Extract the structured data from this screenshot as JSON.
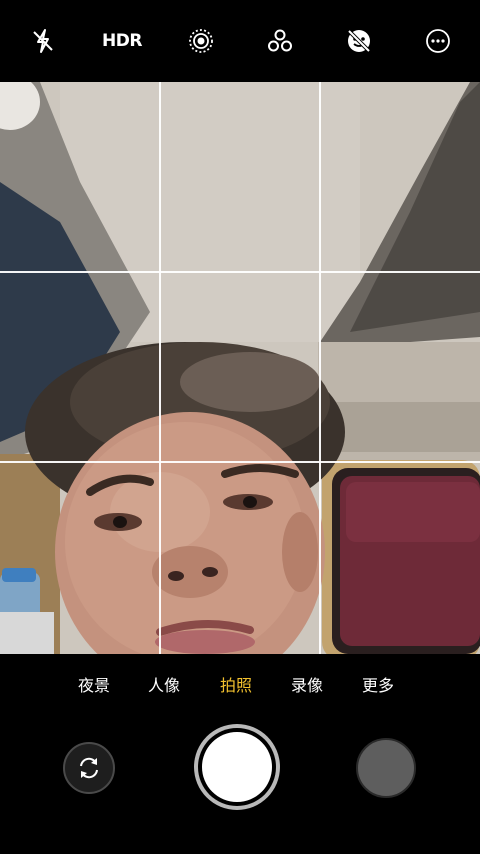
{
  "top_toolbar": {
    "icons": [
      "flash-off-icon",
      "hdr-off-icon",
      "live-photo-icon",
      "filters-icon",
      "beauty-off-icon",
      "more-options-icon"
    ],
    "hdr_label": "HDR"
  },
  "modes": {
    "items": [
      "夜景",
      "人像",
      "拍照",
      "录像",
      "更多"
    ],
    "active": "拍照"
  },
  "colors": {
    "active_mode": "#f2c12e",
    "background": "#000000",
    "grid": "#ffffff"
  },
  "bottom_controls": {
    "switch_camera_icon": "switch-camera-icon",
    "shutter": "shutter-button",
    "gallery": "gallery-thumbnail"
  }
}
